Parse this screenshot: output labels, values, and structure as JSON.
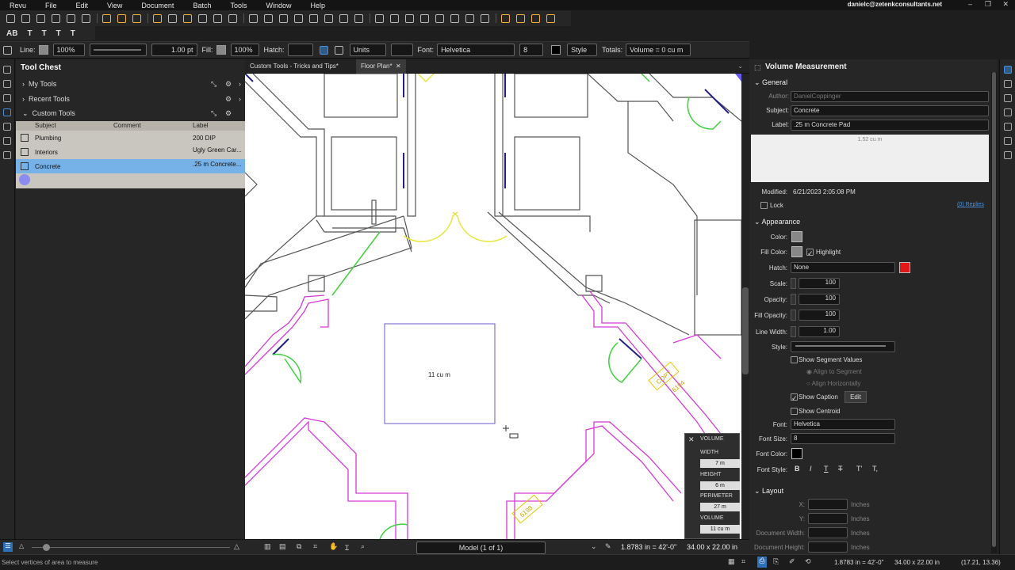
{
  "menu": {
    "items": [
      "Revu",
      "File",
      "Edit",
      "View",
      "Document",
      "Batch",
      "Tools",
      "Window",
      "Help"
    ],
    "account": "danielc@zetenkconsultants.net"
  },
  "properties_bar": {
    "line_label": "Line:",
    "line_opacity": "100%",
    "line_width": "1.00 pt",
    "fill_label": "Fill:",
    "fill_opacity": "100%",
    "hatch_label": "Hatch:",
    "units": "Units",
    "font_label": "Font:",
    "font": "Helvetica",
    "font_size": "8",
    "style": "Style",
    "totals_label": "Totals:",
    "totals_value": "Volume = 0 cu m"
  },
  "toolchest": {
    "title": "Tool Chest",
    "sections": [
      "My Tools",
      "Recent Tools",
      "Custom Tools"
    ],
    "columns": [
      "Subject",
      "Comment",
      "Label"
    ],
    "rows": [
      {
        "subject": "Plumbing",
        "comment": "",
        "label": "200 DIP"
      },
      {
        "subject": "Interiors",
        "comment": "",
        "label": "Ugly Green Car..."
      },
      {
        "subject": "Concrete",
        "comment": "",
        "label": ".25 m Concrete..."
      }
    ]
  },
  "tabs": [
    {
      "label": "Custom Tools - Tricks and Tips*"
    },
    {
      "label": "Floor Plan*"
    }
  ],
  "canvas": {
    "shape_label": "11 cu m",
    "tags": [
      "COPY",
      "6194",
      "6198"
    ],
    "measure_panel": {
      "title": "VOLUME",
      "width_label": "WIDTH",
      "width": "7 m",
      "height_label": "HEIGHT",
      "height": "6 m",
      "perimeter_label": "PERIMETER",
      "perimeter": "27 m",
      "volume_label": "VOLUME",
      "volume": "11 cu m"
    }
  },
  "bottom": {
    "page": "Model (1 of 1)",
    "scale": "1.8783 in = 42'-0\"",
    "page_size": "34.00 x 22.00 in"
  },
  "status": {
    "hint": "Select vertices of area to measure",
    "scale": "1.8783 in = 42'-0\"",
    "size": "34.00 x 22.00 in",
    "coords": "(17.21, 13.36)"
  },
  "right_panel": {
    "title": "Volume Measurement",
    "general": "General",
    "author_label": "Author:",
    "author": "DanielCoppinger",
    "subject_label": "Subject:",
    "subject": "Concrete",
    "label_label": "Label:",
    "label": ".25 m Concrete Pad",
    "preview": "1.52 cu m",
    "modified_label": "Modified:",
    "modified": "6/21/2023 2:05:08 PM",
    "lock": "Lock",
    "replies": "(0) Replies",
    "appearance": "Appearance",
    "color_label": "Color:",
    "fill_color_label": "Fill Color:",
    "highlight": "Highlight",
    "hatch_label": "Hatch:",
    "hatch": "None",
    "scale_label": "Scale:",
    "scale": "100",
    "opacity_label": "Opacity:",
    "opacity": "100",
    "fill_opacity_label": "Fill Opacity:",
    "fill_opacity": "100",
    "line_width_label": "Line Width:",
    "line_width": "1.00",
    "style_label": "Style:",
    "show_segment_values": "Show Segment Values",
    "align_segment": "Align to Segment",
    "align_horizontal": "Align Horizontally",
    "show_caption": "Show Caption",
    "edit": "Edit",
    "show_centroid": "Show Centroid",
    "font_label": "Font:",
    "font": "Helvetica",
    "font_size_label": "Font Size:",
    "font_size": "8",
    "font_color_label": "Font Color:",
    "font_style_label": "Font Style:",
    "layout": "Layout",
    "x_label": "X:",
    "y_label": "Y:",
    "doc_width_label": "Document Width:",
    "doc_height_label": "Document Height:",
    "unit": "Inches"
  },
  "colors": {
    "accent": "#4a90d9",
    "selected_row": "#76b1e8",
    "magenta": "#d63ad6",
    "green": "#3fd13f",
    "yellow": "#e6e63c"
  }
}
